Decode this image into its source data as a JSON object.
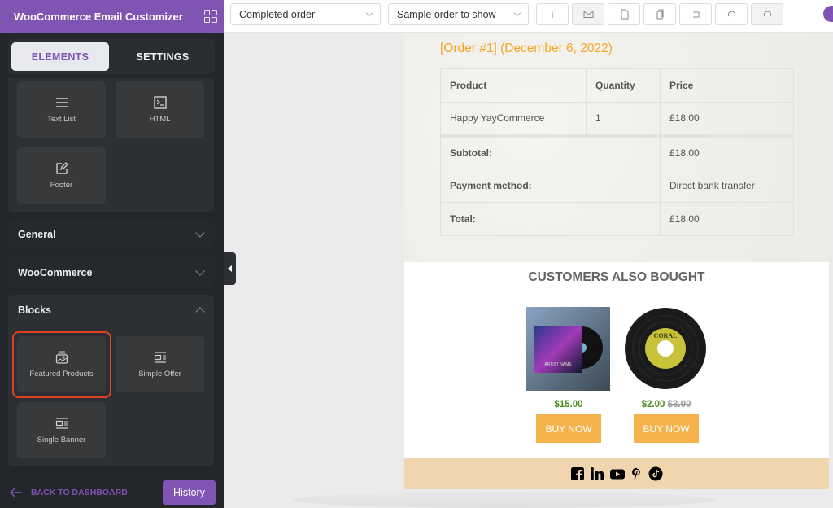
{
  "sidebar": {
    "title": "WooCommerce Email Customizer",
    "tabs": [
      {
        "label": "ELEMENTS",
        "active": true
      },
      {
        "label": "SETTINGS",
        "active": false
      }
    ],
    "elements": [
      {
        "label": "Text List",
        "icon": "text-list-icon"
      },
      {
        "label": "HTML",
        "icon": "terminal-icon"
      },
      {
        "label": "Footer",
        "icon": "edit-icon"
      }
    ],
    "sections": [
      {
        "label": "General",
        "expanded": false
      },
      {
        "label": "WooCommerce",
        "expanded": false
      },
      {
        "label": "Blocks",
        "expanded": true
      }
    ],
    "blocks": [
      {
        "label": "Featured Products",
        "icon": "image-stack-icon",
        "highlighted": true
      },
      {
        "label": "Simple Offer",
        "icon": "layout-block-icon"
      },
      {
        "label": "Single Banner",
        "icon": "layout-block-icon"
      }
    ],
    "back_label": "BACK TO DASHBOARD",
    "history_label": "History"
  },
  "toolbar": {
    "email_type": "Completed order",
    "sample_order": "Sample order to show",
    "buttons": [
      "info",
      "send-email",
      "new-file",
      "copy",
      "undo",
      "redo",
      "reset"
    ],
    "accent": "#7f54b3"
  },
  "email": {
    "order_title": "[Order #1] (December 6, 2022)",
    "table": {
      "headers": [
        "Product",
        "Quantity",
        "Price"
      ],
      "rows": [
        [
          "Happy YayCommerce",
          "1",
          "£18.00"
        ]
      ],
      "totals": [
        {
          "label": "Subtotal:",
          "value": "£18.00"
        },
        {
          "label": "Payment method:",
          "value": "Direct bank transfer"
        },
        {
          "label": "Total:",
          "value": "£18.00"
        }
      ]
    },
    "also_bought_title": "CUSTOMERS ALSO BOUGHT",
    "products": [
      {
        "price": "$15.00",
        "old_price": "",
        "button": "BUY NOW",
        "image": "album-vinyl-cover"
      },
      {
        "price": "$2.00",
        "old_price": "$3.00",
        "button": "BUY NOW",
        "image": "coral-vinyl-record"
      }
    ],
    "social": [
      "facebook",
      "linkedin",
      "youtube",
      "pinterest",
      "tiktok"
    ]
  }
}
